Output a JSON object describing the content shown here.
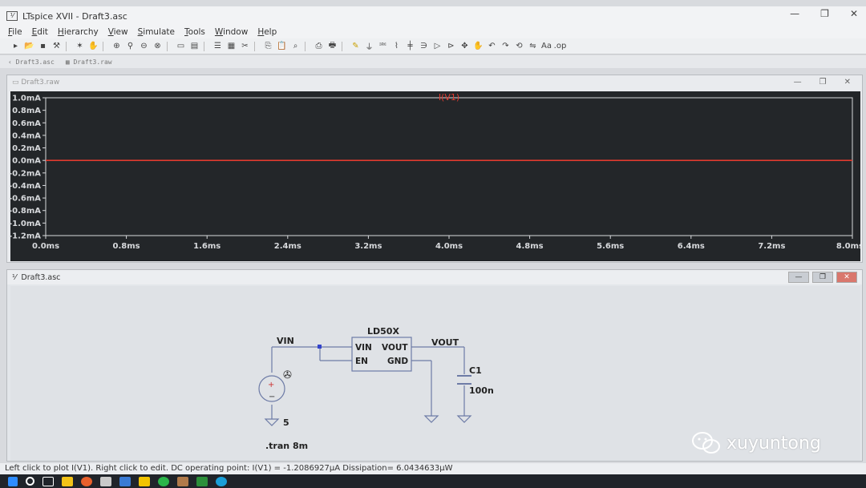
{
  "window": {
    "title": "LTspice XVII - Draft3.asc",
    "app_icon": "ltspice-icon",
    "controls": [
      "—",
      "❐",
      "✕"
    ]
  },
  "menu": [
    "File",
    "Edit",
    "Hierarchy",
    "View",
    "Simulate",
    "Tools",
    "Window",
    "Help"
  ],
  "toolbar_icons": [
    "new-schematic-icon",
    "open-icon",
    "save-icon",
    "control-panel-icon",
    "run-icon",
    "halt-icon",
    "zoom-in-icon",
    "pan-icon",
    "zoom-out-icon",
    "zoom-fit-icon",
    "autoscale-icon",
    "tile-icon",
    "cascade-icon",
    "close-icon",
    "cut-icon",
    "copy-icon",
    "paste-icon",
    "find-icon",
    "print-icon",
    "print-preview-icon",
    "wire-icon",
    "ground-icon",
    "label-icon",
    "resistor-icon",
    "capacitor-icon",
    "inductor-icon",
    "diode-icon",
    "component-icon",
    "move-icon",
    "drag-icon",
    "undo-icon",
    "redo-icon",
    "rotate-icon",
    "mirror-icon",
    "text-icon",
    "spice-directive-icon"
  ],
  "doc_tabs": [
    "Draft3.asc",
    "Draft3.raw"
  ],
  "waveform": {
    "title": "Draft3.raw",
    "trace_label": "I(V1)",
    "trace_color": "#e03a2f",
    "background": "#232629",
    "axis_color": "#d7d9dc"
  },
  "chart_data": {
    "type": "line",
    "title": "",
    "series": [
      {
        "name": "I(V1)",
        "x": [
          0.0,
          8.0
        ],
        "y": [
          0.0,
          -1.2e-06
        ],
        "color": "#e03a2f"
      }
    ],
    "x_ticks": [
      "0.0ms",
      "0.8ms",
      "1.6ms",
      "2.4ms",
      "3.2ms",
      "4.0ms",
      "4.8ms",
      "5.6ms",
      "6.4ms",
      "7.2ms",
      "8.0ms"
    ],
    "y_ticks": [
      "1.0mA",
      "0.8mA",
      "0.6mA",
      "0.4mA",
      "0.2mA",
      "0.0mA",
      "-0.2mA",
      "-0.4mA",
      "-0.6mA",
      "-0.8mA",
      "-1.0mA",
      "-1.2mA"
    ],
    "xlim": [
      0.0,
      8.0
    ],
    "ylim": [
      -1.2,
      1.0
    ],
    "xunit": "ms",
    "yunit": "mA"
  },
  "schematic": {
    "title": "Draft3.asc",
    "ic_name": "LD50X",
    "ic_pins_left": [
      "VIN",
      "EN"
    ],
    "ic_pins_right": [
      "VOUT",
      "GND"
    ],
    "net_vin": "VIN",
    "net_vout": "VOUT",
    "cap_name": "C1",
    "cap_value": "100n",
    "source_value": "5",
    "directive": ".tran 8m",
    "wire_color": "#6d7ba6"
  },
  "status": "Left click to plot I(V1).  Right click to edit.  DC operating point: I(V1) = -1.2086927µA  Dissipation= 6.0434633µW",
  "watermark": "xuyuntong"
}
